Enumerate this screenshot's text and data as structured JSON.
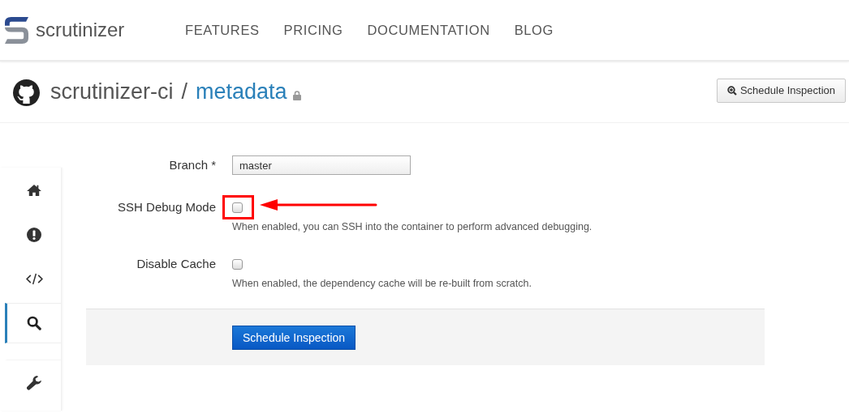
{
  "header": {
    "brand": "scrutinizer",
    "nav": [
      {
        "label": "FEATURES"
      },
      {
        "label": "PRICING"
      },
      {
        "label": "DOCUMENTATION"
      },
      {
        "label": "BLOG"
      }
    ]
  },
  "repo": {
    "owner": "scrutinizer-ci",
    "separator": "/",
    "name": "metadata",
    "private": true,
    "action": "Schedule Inspection"
  },
  "sidebar": {
    "items": [
      {
        "selected": false
      },
      {
        "selected": false
      },
      {
        "selected": false
      },
      {
        "selected": true
      },
      {
        "selected": false
      }
    ]
  },
  "form": {
    "branch": {
      "label": "Branch *",
      "value": "master"
    },
    "options": [
      {
        "label": "SSH Debug Mode",
        "checked": false,
        "highlighted": true,
        "help": "When enabled, you can SSH into the container to perform advanced debugging."
      },
      {
        "label": "Disable Cache",
        "checked": false,
        "highlighted": false,
        "help": "When enabled, the dependency cache will be re-built from scratch."
      }
    ],
    "submit": "Schedule Inspection"
  }
}
